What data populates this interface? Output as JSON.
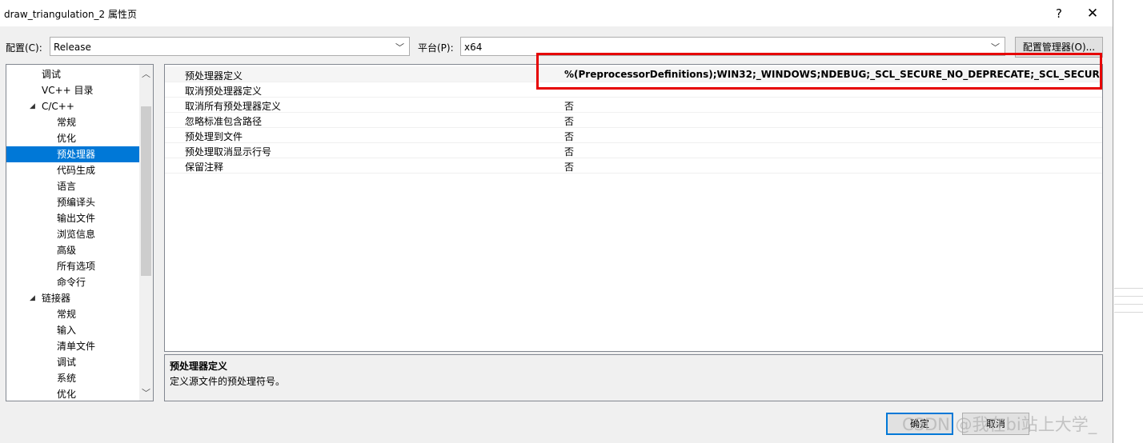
{
  "window": {
    "title": "draw_triangulation_2 属性页",
    "help_glyph": "?",
    "close_glyph": "✕"
  },
  "config": {
    "config_label": "配置(C):",
    "config_value": "Release",
    "platform_label": "平台(P):",
    "platform_value": "x64",
    "manager_button": "配置管理器(O)..."
  },
  "tree": {
    "items": [
      {
        "label": "调试",
        "level": 1
      },
      {
        "label": "VC++ 目录",
        "level": 1
      },
      {
        "label": "C/C++",
        "level": 1,
        "expanded": true
      },
      {
        "label": "常规",
        "level": 2
      },
      {
        "label": "优化",
        "level": 2
      },
      {
        "label": "预处理器",
        "level": 2,
        "selected": true
      },
      {
        "label": "代码生成",
        "level": 2
      },
      {
        "label": "语言",
        "level": 2
      },
      {
        "label": "预编译头",
        "level": 2
      },
      {
        "label": "输出文件",
        "level": 2
      },
      {
        "label": "浏览信息",
        "level": 2
      },
      {
        "label": "高级",
        "level": 2
      },
      {
        "label": "所有选项",
        "level": 2
      },
      {
        "label": "命令行",
        "level": 2
      },
      {
        "label": "链接器",
        "level": 1,
        "expanded": true
      },
      {
        "label": "常规",
        "level": 2
      },
      {
        "label": "输入",
        "level": 2
      },
      {
        "label": "清单文件",
        "level": 2
      },
      {
        "label": "调试",
        "level": 2
      },
      {
        "label": "系统",
        "level": 2
      },
      {
        "label": "优化",
        "level": 2
      }
    ]
  },
  "grid": {
    "rows": [
      {
        "name": "预处理器定义",
        "value": "%(PreprocessorDefinitions);WIN32;_WINDOWS;NDEBUG;_SCL_SECURE_NO_DEPRECATE;_SCL_SECURE_NO_WAR",
        "bold": true
      },
      {
        "name": "取消预处理器定义",
        "value": ""
      },
      {
        "name": "取消所有预处理器定义",
        "value": "否"
      },
      {
        "name": "忽略标准包含路径",
        "value": "否"
      },
      {
        "name": "预处理到文件",
        "value": "否"
      },
      {
        "name": "预处理取消显示行号",
        "value": "否"
      },
      {
        "name": "保留注释",
        "value": "否"
      }
    ]
  },
  "description": {
    "title": "预处理器定义",
    "text": "定义源文件的预处理符号。"
  },
  "buttons": {
    "ok": "确定",
    "cancel": "取消"
  },
  "watermark": "CSDN @我在bi站上大学_",
  "colors": {
    "highlight": "#e60000",
    "selection": "#0078d7"
  }
}
